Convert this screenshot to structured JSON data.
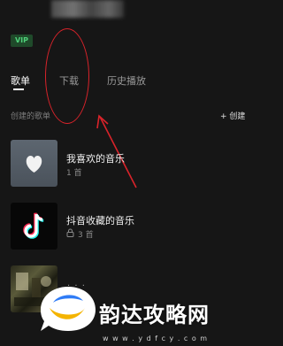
{
  "profile": {
    "vip_label": "VIP"
  },
  "tabs": [
    {
      "label": "歌单",
      "active": true
    },
    {
      "label": "下载",
      "active": false
    },
    {
      "label": "历史播放",
      "active": false
    }
  ],
  "section": {
    "title": "创建的歌单",
    "create_label": "+ 创建"
  },
  "playlists": [
    {
      "title": "我喜欢的音乐",
      "subtitle": "1 首",
      "cover_icon": "heart-icon"
    },
    {
      "title": "抖音收藏的音乐",
      "subtitle": "3 首",
      "cover_icon": "douyin-logo-icon",
      "locked": true
    },
    {
      "title": "· · ·",
      "subtitle": "",
      "cover_icon": "album-cover-image"
    }
  ],
  "watermark": {
    "brand": "韵达攻略网",
    "url": "w w w . y d f c y . c o m"
  },
  "colors": {
    "background": "#161616",
    "vip_green": "#4fd17a",
    "annotation_red": "#d9232a"
  }
}
